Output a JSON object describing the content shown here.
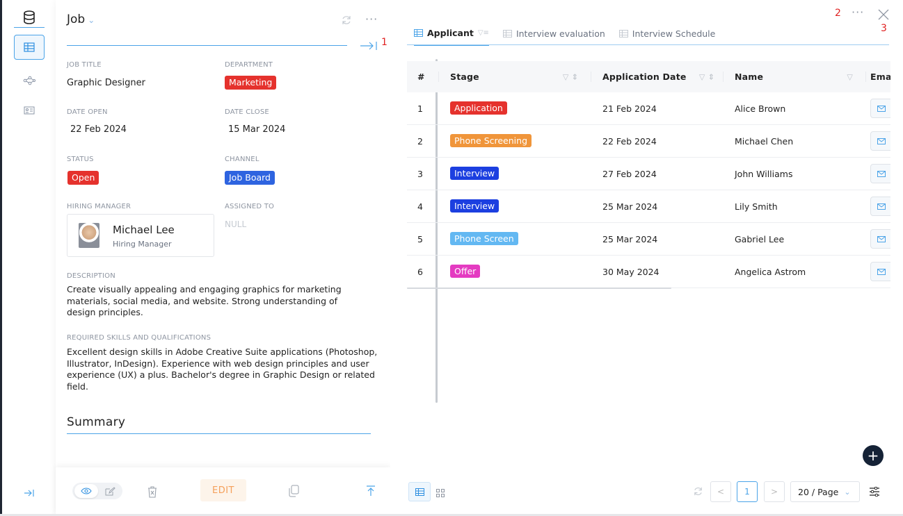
{
  "left_panel": {
    "title": "Job",
    "fields": {
      "job_title_label": "JOB TITLE",
      "job_title": "Graphic Designer",
      "department_label": "DEPARTMENT",
      "department": "Marketing",
      "date_open_label": "DATE OPEN",
      "date_open": "22 Feb 2024",
      "date_close_label": "DATE CLOSE",
      "date_close": "15 Mar 2024",
      "status_label": "STATUS",
      "status": "Open",
      "channel_label": "CHANNEL",
      "channel": "Job Board",
      "hiring_manager_label": "HIRING MANAGER",
      "hiring_manager_name": "Michael Lee",
      "hiring_manager_role": "Hiring Manager",
      "assigned_to_label": "ASSIGNED TO",
      "assigned_to": "NULL",
      "description_label": "DESCRIPTION",
      "description": "Create visually appealing and engaging graphics for marketing materials, social media, and website. Strong understanding of design principles.",
      "skills_label": "REQUIRED SKILLS AND QUALIFICATIONS",
      "skills": "Excellent design skills in Adobe Creative Suite applications (Photoshop, Illustrator, InDesign). Experience with web design principles and user experience (UX) a plus. Bachelor's degree in Graphic Design or related field."
    },
    "summary_title": "Summary",
    "edit_label": "EDIT"
  },
  "tabs": [
    {
      "label": "Applicant",
      "active": true
    },
    {
      "label": "Interview evaluation",
      "active": false
    },
    {
      "label": "Interview Schedule",
      "active": false
    }
  ],
  "table": {
    "headers": [
      "#",
      "Stage",
      "Application Date",
      "Name",
      "Emai"
    ],
    "rows": [
      {
        "num": "1",
        "stage": "Application",
        "color": "#e5322d",
        "date": "21 Feb 2024",
        "name": "Alice Brown"
      },
      {
        "num": "2",
        "stage": "Phone Screening",
        "color": "#f0953a",
        "date": "22 Feb 2024",
        "name": "Michael Chen"
      },
      {
        "num": "3",
        "stage": "Interview",
        "color": "#1c3fe0",
        "date": "27 Feb 2024",
        "name": "John Williams"
      },
      {
        "num": "4",
        "stage": "Interview",
        "color": "#1c3fe0",
        "date": "25 Mar 2024",
        "name": "Lily Smith"
      },
      {
        "num": "5",
        "stage": "Phone Screen",
        "color": "#63b8f2",
        "date": "25 Mar 2024",
        "name": "Gabriel Lee"
      },
      {
        "num": "6",
        "stage": "Offer",
        "color": "#e43bc1",
        "date": "30 May 2024",
        "name": "Angelica Astrom"
      }
    ]
  },
  "pagination": {
    "current_page": "1",
    "page_size": "20 / Page"
  },
  "annotations": {
    "a1": "1",
    "a2": "2",
    "a3": "3"
  },
  "colors": {
    "accent": "#4aa3e8",
    "marketing": "#e5322d",
    "open": "#e5322d",
    "job_board": "#2e64e0"
  }
}
